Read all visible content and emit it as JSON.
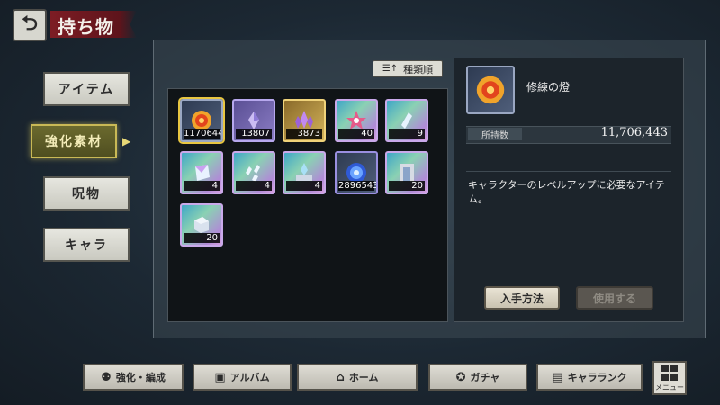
{
  "header": {
    "back_icon": "back-arrow-icon",
    "title": "持ち物"
  },
  "side_tabs": [
    {
      "label": "アイテム",
      "active": false
    },
    {
      "label": "強化素材",
      "active": true
    },
    {
      "label": "呪物",
      "active": false
    },
    {
      "label": "キャラ",
      "active": false
    }
  ],
  "sort_button": {
    "label": "種類順",
    "icon": "sort-icon"
  },
  "items": [
    {
      "qty": "11706443",
      "icon": "fire-orb-icon",
      "rarity": "fire",
      "selected": true
    },
    {
      "qty": "13807",
      "icon": "purple-crystal-icon",
      "rarity": "purple"
    },
    {
      "qty": "3873",
      "icon": "purple-crystal-cluster-icon",
      "rarity": "gold"
    },
    {
      "qty": "40",
      "icon": "star-crystal-icon",
      "rarity": "rainbow"
    },
    {
      "qty": "9",
      "icon": "shard-icon",
      "rarity": "rainbow"
    },
    {
      "qty": "4",
      "icon": "prism-crystal-icon",
      "rarity": "rainbow"
    },
    {
      "qty": "4",
      "icon": "sparkle-shards-icon",
      "rarity": "rainbow"
    },
    {
      "qty": "4",
      "icon": "crystal-altar-icon",
      "rarity": "rainbow"
    },
    {
      "qty": "2896543",
      "icon": "blue-orb-icon",
      "rarity": "fire"
    },
    {
      "qty": "20",
      "icon": "stone-gate-icon",
      "rarity": "rainbow"
    },
    {
      "qty": "20",
      "icon": "stone-block-icon",
      "rarity": "rainbow"
    }
  ],
  "detail": {
    "icon": "fire-orb-icon",
    "name": "修練の燈",
    "held_label": "所持数",
    "held_value": "11,706,443",
    "description": "キャラクターのレベルアップに必要なアイテム。",
    "acquire_label": "入手方法",
    "use_label": "使用する"
  },
  "bottom_nav": [
    {
      "label": "強化・編成",
      "icon": "party-icon"
    },
    {
      "label": "アルバム",
      "icon": "album-icon"
    },
    {
      "label": "ホーム",
      "icon": "home-icon"
    },
    {
      "label": "ガチャ",
      "icon": "gacha-icon"
    },
    {
      "label": "キャラランク",
      "icon": "rank-icon"
    }
  ],
  "menu": {
    "label": "メニュー",
    "icon": "menu-grid-icon"
  },
  "colors": {
    "accent_gold": "#c9b956",
    "title_red": "#7d1c24",
    "selected_outline": "#e8c641"
  }
}
